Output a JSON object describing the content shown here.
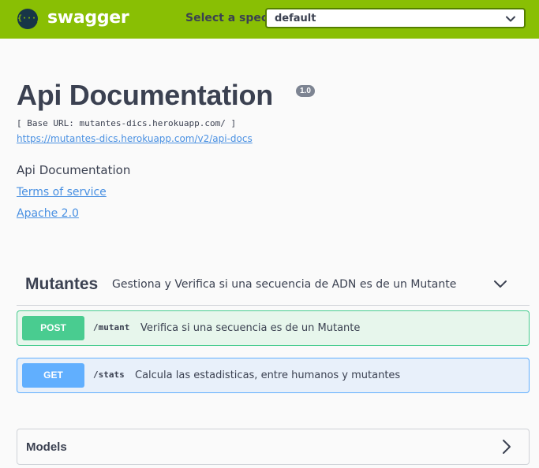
{
  "topbar": {
    "logo_glyph": "{···}",
    "logo_text": "swagger",
    "spec_label": "Select a spec",
    "spec_selected": "default",
    "bg_color": "#89bf04"
  },
  "info": {
    "title": "Api Documentation",
    "version": "1.0",
    "base_url": "[ Base URL: mutantes-dics.herokuapp.com/ ]",
    "docs_url": "https://mutantes-dics.herokuapp.com/v2/api-docs",
    "description": "Api Documentation",
    "terms_label": "Terms of service",
    "license_label": "Apache 2.0"
  },
  "tag": {
    "name": "Mutantes",
    "description": "Gestiona y Verifica si una secuencia de ADN es de un Mutante",
    "expanded": true
  },
  "operations": [
    {
      "method": "POST",
      "path": "/mutant",
      "summary": "Verifica si una secuencia es de un Mutante",
      "color": "#49cc90"
    },
    {
      "method": "GET",
      "path": "/stats",
      "summary": "Calcula las estadisticas, entre humanos y mutantes",
      "color": "#61affe"
    }
  ],
  "models": {
    "label": "Models",
    "expanded": false
  }
}
